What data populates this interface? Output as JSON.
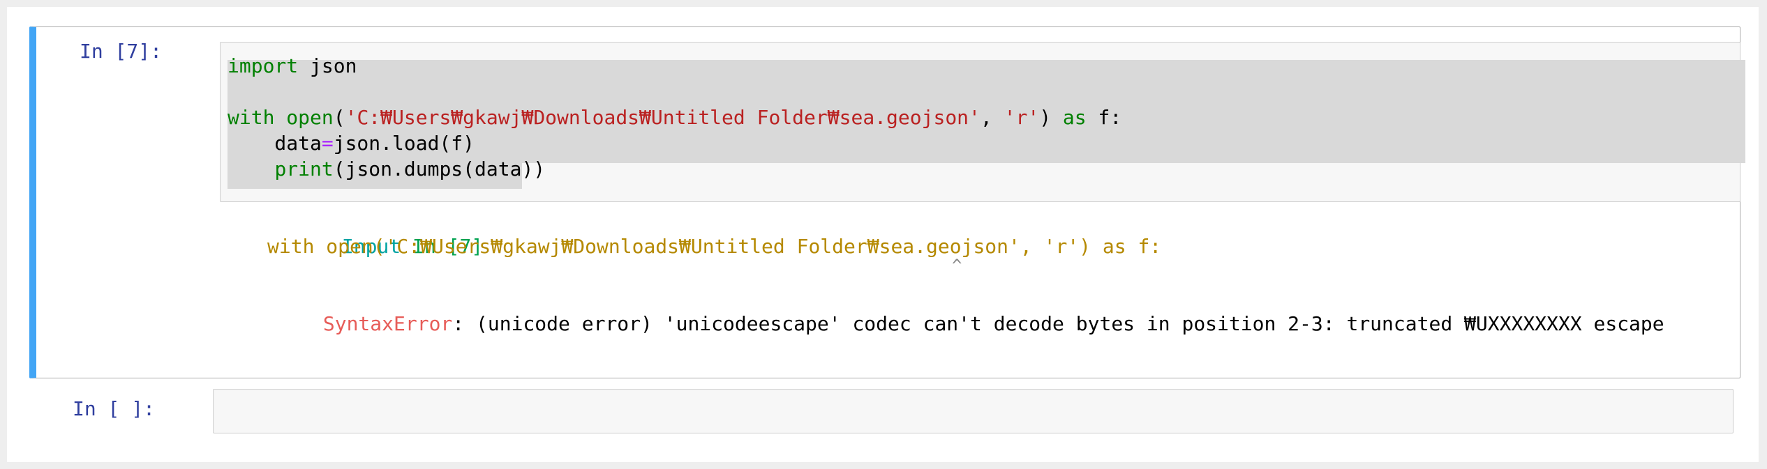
{
  "cells": [
    {
      "prompt": "In [7]:",
      "code_lines": [
        [
          {
            "t": "import",
            "c": "kw"
          },
          {
            "t": " json",
            "c": ""
          }
        ],
        [],
        [
          {
            "t": "with",
            "c": "kw"
          },
          {
            "t": " ",
            "c": ""
          },
          {
            "t": "open",
            "c": "builtin"
          },
          {
            "t": "(",
            "c": ""
          },
          {
            "t": "'C:₩Users₩gkawj₩Downloads₩Untitled Folder₩sea.geojson'",
            "c": "str"
          },
          {
            "t": ", ",
            "c": ""
          },
          {
            "t": "'r'",
            "c": "str"
          },
          {
            "t": ") ",
            "c": ""
          },
          {
            "t": "as",
            "c": "kw"
          },
          {
            "t": " f:",
            "c": ""
          }
        ],
        [
          {
            "t": "    data",
            "c": ""
          },
          {
            "t": "=",
            "c": "op"
          },
          {
            "t": "json.load(f)",
            "c": ""
          }
        ],
        [
          {
            "t": "    ",
            "c": ""
          },
          {
            "t": "print",
            "c": "builtin"
          },
          {
            "t": "(json.dumps(data))",
            "c": ""
          }
        ]
      ],
      "output": {
        "tb_header_label": "Input",
        "tb_header_ref": "In [7]",
        "tb_code": "with open('C:₩Users₩gkawj₩Downloads₩Untitled Folder₩sea.geojson', 'r') as f:",
        "tb_caret": "^",
        "error_name": "SyntaxError",
        "error_message": ": (unicode error) 'unicodeescape' codec can't decode bytes in position 2-3: truncated ₩UXXXXXXXX escape"
      }
    },
    {
      "prompt": "In [ ]:",
      "code_lines": []
    }
  ],
  "colors": {
    "selected_cell_bar": "#42a5f5",
    "prompt": "#303f9f",
    "keyword": "#008000",
    "string": "#ba2121",
    "error_name": "#e75c58"
  }
}
